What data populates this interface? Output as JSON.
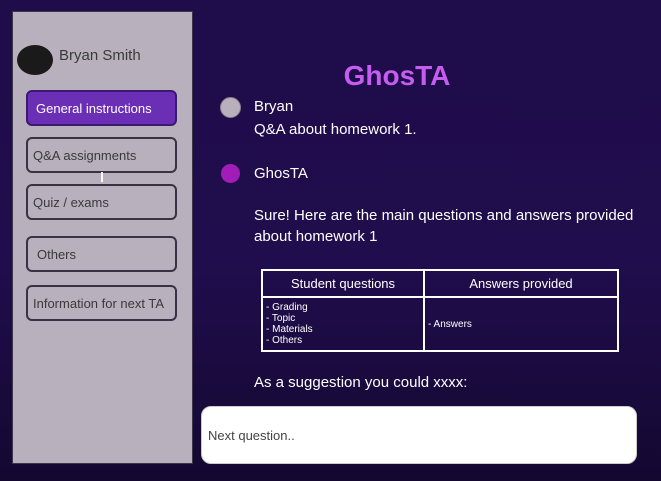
{
  "sidebar": {
    "user_name": "Bryan Smith",
    "items": [
      {
        "label": "General instructions",
        "active": true
      },
      {
        "label": "Q&A assignments",
        "active": false
      },
      {
        "label": "Quiz / exams",
        "active": false
      },
      {
        "label": "Others",
        "active": false
      },
      {
        "label": "Information for next TA",
        "active": false
      }
    ]
  },
  "header": {
    "title": "GhosTA"
  },
  "messages": [
    {
      "author": "Bryan",
      "lines": [
        "Q&A about homework 1."
      ],
      "dot_color": "#b8b0bc"
    },
    {
      "author": "GhosTA",
      "lines": [
        "Sure! Here are the main questions and answers provided",
        "about homework 1"
      ],
      "dot_color": "#a21cb8"
    }
  ],
  "table": {
    "headers": [
      "Student questions",
      "Answers provided"
    ],
    "questions": [
      "- Grading",
      "- Topic",
      "- Materials",
      "- Others"
    ],
    "answers": [
      "- Answers"
    ]
  },
  "suggestion": "As a suggestion you could xxxx:",
  "input": {
    "placeholder": "Next question.."
  },
  "colors": {
    "accent": "#6a2fb5",
    "title": "#c75cf0",
    "background": "#1f0c4a"
  }
}
